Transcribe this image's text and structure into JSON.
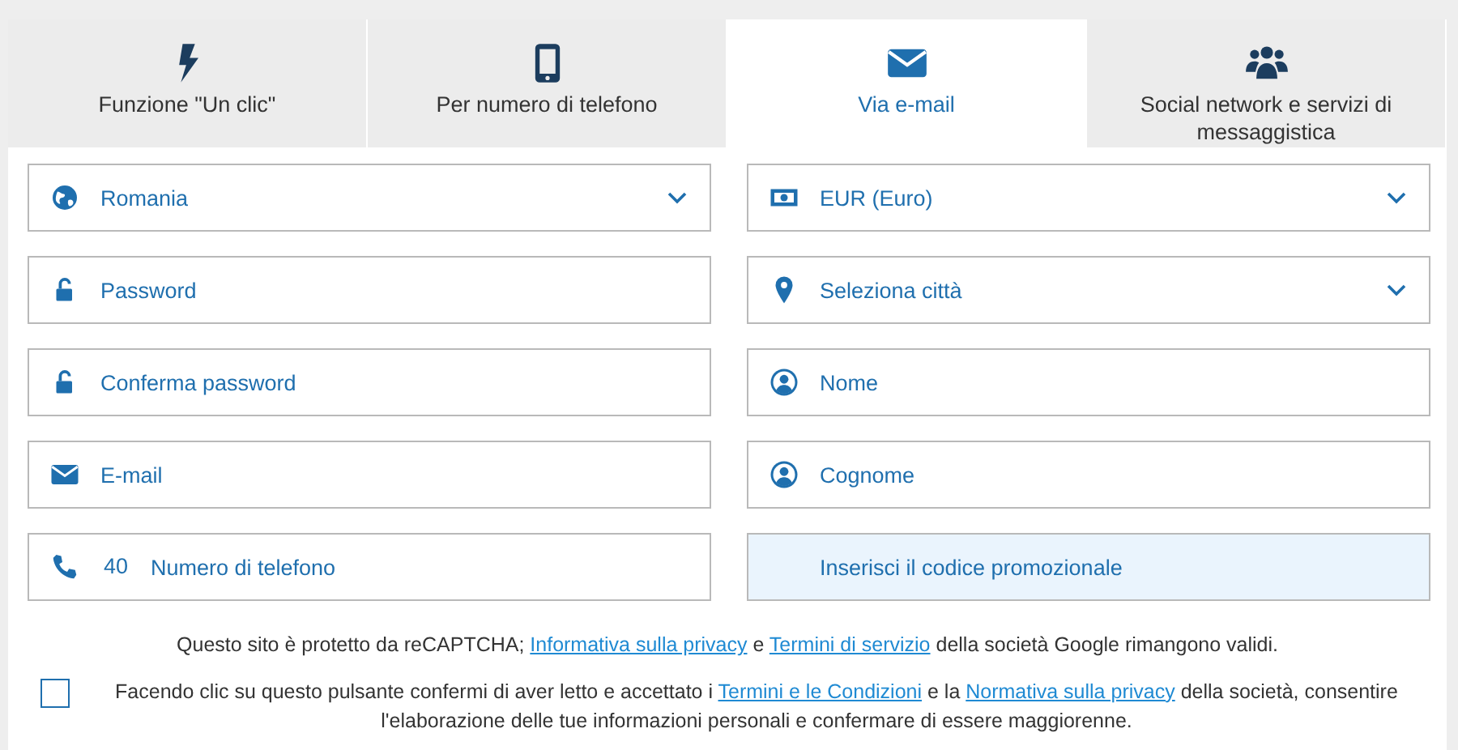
{
  "tabs": [
    {
      "label": "Funzione \"Un clic\"",
      "selected": false
    },
    {
      "label": "Per numero di telefono",
      "selected": false
    },
    {
      "label": "Via e-mail",
      "selected": true
    },
    {
      "label": "Social network e servizi di messaggistica",
      "selected": false
    }
  ],
  "fields": [
    {
      "kind": "select",
      "value": "Romania"
    },
    {
      "kind": "select",
      "value": "EUR (Euro)"
    },
    {
      "kind": "input",
      "placeholder": "Password"
    },
    {
      "kind": "select",
      "placeholder": "Seleziona città"
    },
    {
      "kind": "input",
      "placeholder": "Conferma password"
    },
    {
      "kind": "input",
      "placeholder": "Nome"
    },
    {
      "kind": "input",
      "placeholder": "E-mail"
    },
    {
      "kind": "input",
      "placeholder": "Cognome"
    },
    {
      "kind": "phone",
      "prefix": "40",
      "placeholder": "Numero di telefono"
    },
    {
      "kind": "promo",
      "placeholder": "Inserisci il codice promozionale"
    }
  ],
  "recaptcha_notice": [
    {
      "kind": "text",
      "text": "Questo sito è protetto da reCAPTCHA; "
    },
    {
      "kind": "link",
      "text": "Informativa sulla privacy"
    },
    {
      "kind": "text",
      "text": " e "
    },
    {
      "kind": "link",
      "text": "Termini di servizio"
    },
    {
      "kind": "text",
      "text": " della società Google rimangono validi."
    }
  ],
  "consent": {
    "checked": false,
    "parts": [
      {
        "kind": "text",
        "text": "Facendo clic su questo pulsante confermi di aver letto e accettato i "
      },
      {
        "kind": "link",
        "text": "Termini e le Condizioni"
      },
      {
        "kind": "text",
        "text": " e la "
      },
      {
        "kind": "link",
        "text": "Normativa sulla privacy"
      },
      {
        "kind": "text",
        "text": " della società, consentire l'elaborazione delle tue informazioni personali e confermare di essere maggiorenne."
      }
    ]
  }
}
